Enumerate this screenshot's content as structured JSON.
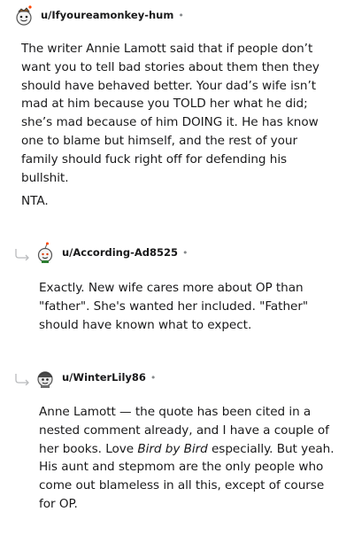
{
  "comments": [
    {
      "username": "u/Ifyoureamonkey-hum",
      "separator": "•",
      "avatar_icon": "snoo-avatar-icon",
      "paragraphs": [
        "The writer Annie Lamott said that if people don’t want you to tell bad stories about them then they should have behaved better. Your dad’s wife isn’t mad at him because you TOLD her what he did; she’s mad because of him DOING it. He has know one to blame but himself, and the rest of your family should fuck right off for defending his bullshit.",
        "NTA."
      ]
    },
    {
      "username": "u/According-Ad8525",
      "separator": "•",
      "avatar_icon": "snoo-avatar-icon",
      "reply_icon": "reply-arrow-icon",
      "paragraphs": [
        "Exactly. New wife cares more about OP than \"father\". She's wanted her included. \"Father\" should have known what to expect."
      ]
    },
    {
      "username": "u/WinterLily86",
      "separator": "•",
      "avatar_icon": "snoo-avatar-icon",
      "reply_icon": "reply-arrow-icon",
      "paragraph_parts": {
        "before_em": "Anne Lamott — the quote has been cited in a nested comment already, and I have a couple of her books. Love ",
        "em": "Bird by Bird",
        "after_em": " especially. But yeah. His aunt and stepmom are the only people who come out blameless in all this, except of course for OP."
      }
    }
  ]
}
